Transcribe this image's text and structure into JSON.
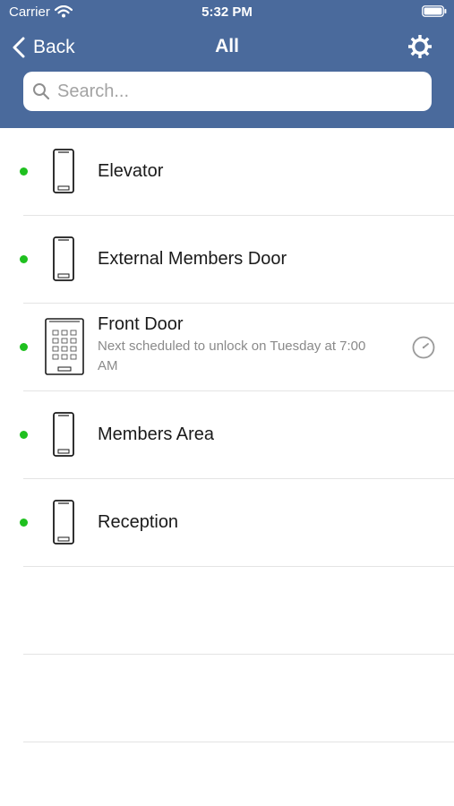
{
  "status_bar": {
    "carrier": "Carrier",
    "time": "5:32 PM"
  },
  "nav": {
    "back_label": "Back",
    "title": "All",
    "settings_icon": "gear-icon"
  },
  "search": {
    "placeholder": "Search..."
  },
  "colors": {
    "header": "#4a6a9c",
    "online_dot": "#1fc01f"
  },
  "devices": [
    {
      "name": "Elevator",
      "icon": "phone-reader-icon",
      "status": "online"
    },
    {
      "name": "External Members Door",
      "icon": "phone-reader-icon",
      "status": "online"
    },
    {
      "name": "Front Door",
      "icon": "keypad-reader-icon",
      "status": "online",
      "subtitle": "Next scheduled to unlock on Tuesday at 7:00 AM",
      "schedule_icon": "clock-icon"
    },
    {
      "name": "Members Area",
      "icon": "phone-reader-icon",
      "status": "online"
    },
    {
      "name": "Reception",
      "icon": "phone-reader-icon",
      "status": "online"
    }
  ]
}
